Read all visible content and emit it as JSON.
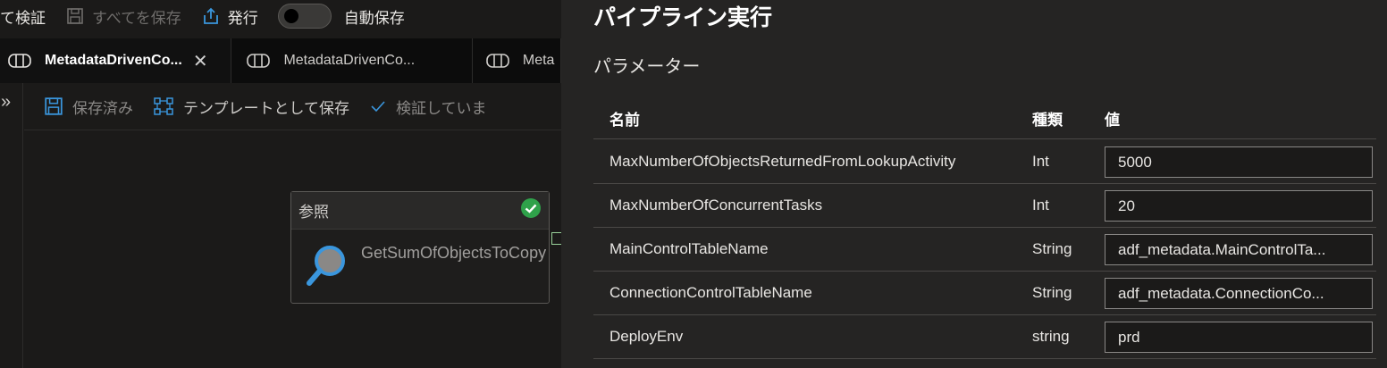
{
  "topbar": {
    "validate_label": "て検証",
    "save_all_label": "すべてを保存",
    "publish_label": "発行",
    "autosave_label": "自動保存",
    "autosave_on": false
  },
  "tabs": [
    {
      "label": "MetadataDrivenCo...",
      "active": true
    },
    {
      "label": "MetadataDrivenCo...",
      "active": false
    },
    {
      "label": "Meta",
      "active": false
    }
  ],
  "toolbar2": {
    "saved_label": "保存済み",
    "save_template_label": "テンプレートとして保存",
    "validating_label": "検証していま"
  },
  "activity": {
    "type_label": "参照",
    "name": "GetSumOfObjectsToCopy"
  },
  "panel": {
    "title": "パイプライン実行",
    "section_title": "パラメーター",
    "columns": {
      "name": "名前",
      "type": "種類",
      "value": "値"
    },
    "rows": [
      {
        "name": "MaxNumberOfObjectsReturnedFromLookupActivity",
        "type": "Int",
        "value": "5000"
      },
      {
        "name": "MaxNumberOfConcurrentTasks",
        "type": "Int",
        "value": "20"
      },
      {
        "name": "MainControlTableName",
        "type": "String",
        "value": "adf_metadata.MainControlTa..."
      },
      {
        "name": "ConnectionControlTableName",
        "type": "String",
        "value": "adf_metadata.ConnectionCo..."
      },
      {
        "name": "DeployEnv",
        "type": "string",
        "value": "prd"
      }
    ]
  },
  "colors": {
    "success": "#2fa14a",
    "accent": "#3a96dd"
  },
  "icons": [
    "save-icon",
    "publish-icon",
    "pipeline-icon",
    "close-icon",
    "expand-chevron-icon",
    "template-icon",
    "check-icon",
    "lookup-icon",
    "success-check-icon"
  ]
}
